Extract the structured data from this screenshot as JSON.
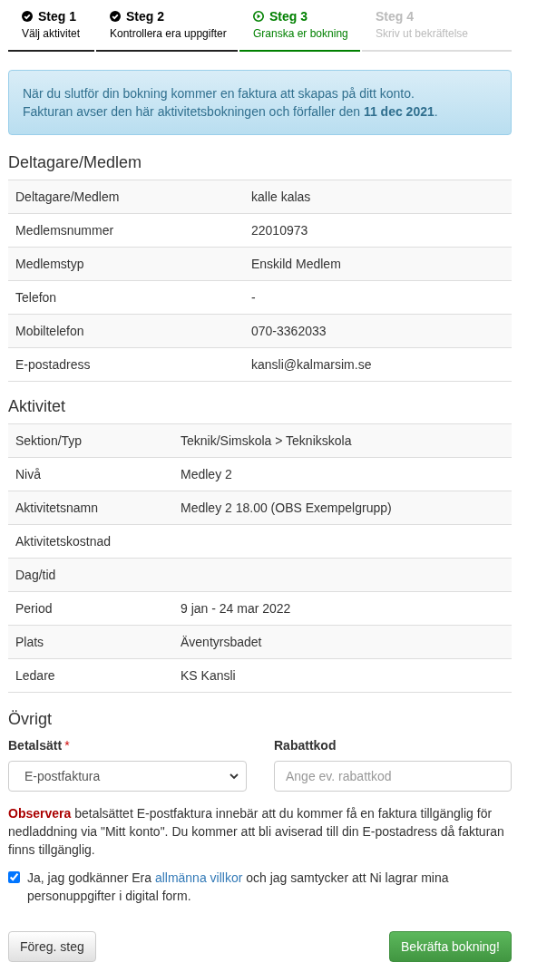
{
  "steps": [
    {
      "title": "Steg 1",
      "subtitle": "Välj aktivitet",
      "completed": true,
      "selected": false
    },
    {
      "title": "Steg 2",
      "subtitle": "Kontrollera era uppgifter",
      "completed": true,
      "selected": false
    },
    {
      "title": "Steg 3",
      "subtitle": "Granska er bokning",
      "completed": false,
      "selected": true
    },
    {
      "title": "Steg 4",
      "subtitle": "Skriv ut bekräftelse",
      "completed": false,
      "selected": false
    }
  ],
  "info_alert": {
    "lines": [
      "När du slutför din bokning kommer en faktura att skapas på ditt konto.",
      "Fakturan avser den här aktivitetsbokningen och förfaller den **11 dec 2021**."
    ]
  },
  "sections": [
    {
      "heading": "Deltagare/Medlem",
      "rows": [
        {
          "label": "Deltagare/Medlem",
          "value": "kalle kalas"
        },
        {
          "label": "Medlemsnummer",
          "value": "22010973"
        },
        {
          "label": "Medlemstyp",
          "value": "Enskild Medlem"
        },
        {
          "label": "Telefon",
          "value": "-"
        },
        {
          "label": "Mobiltelefon",
          "value": "070-3362033"
        },
        {
          "label": "E-postadress",
          "value": "kansli@kalmarsim.se"
        }
      ]
    },
    {
      "heading": "Aktivitet",
      "rows": [
        {
          "label": "Sektion/Typ",
          "value": "Teknik/Simskola > Teknikskola"
        },
        {
          "label": "Nivå",
          "value": "Medley 2"
        },
        {
          "label": "Aktivitetsnamn",
          "value": "Medley 2 18.00 (OBS Exempelgrupp)"
        },
        {
          "label": "Aktivitetskostnad"
        },
        {
          "label": "Dag/tid"
        },
        {
          "label": "Period",
          "value": "9 jan - 24 mar 2022"
        },
        {
          "label": "Plats",
          "value": "Äventyrsbadet"
        },
        {
          "label": "Ledare",
          "value": "KS Kansli"
        }
      ]
    }
  ],
  "other": {
    "heading": "Övrigt",
    "payment": {
      "label": "Betalsätt",
      "required_mark": "*",
      "value": "E-postfaktura"
    },
    "discount": {
      "label": "Rabattkod",
      "placeholder": "Ange ev. rabattkod"
    },
    "note": {
      "label": "Observera",
      "text": "betalsättet E-postfaktura innebär att du kommer få en faktura tillgänglig för nedladdning via \"Mitt konto\". Du kommer att bli aviserad till din E-postadress då fakturan finns tillgänglig."
    },
    "consent": {
      "checked": true,
      "before": "Ja, jag godkänner Era",
      "link": "allmänna villkor",
      "after": "och jag samtycker att Ni lagrar mina personuppgifter i digital form."
    }
  },
  "buttons": {
    "back": "Föreg. steg",
    "confirm": "Bekräfta bokning!"
  }
}
